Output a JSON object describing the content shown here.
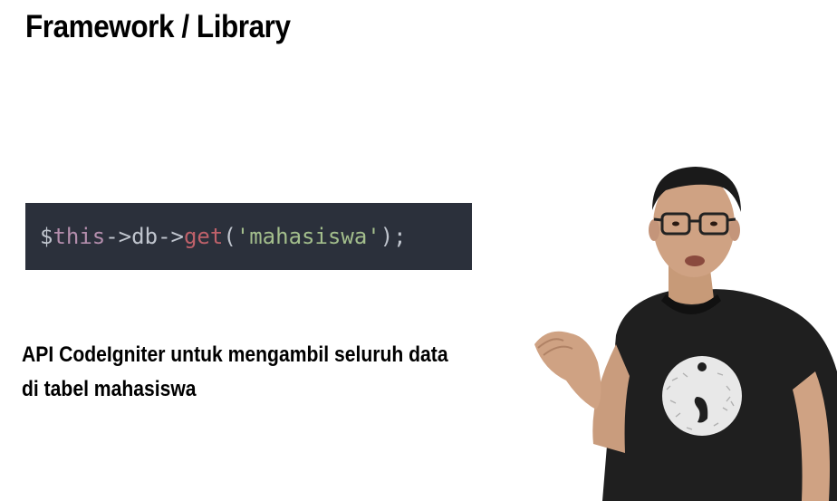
{
  "slide": {
    "title": "Framework / Library",
    "code": {
      "dollar": "$",
      "this": "this",
      "arrow1": "->",
      "prop": "db",
      "arrow2": "->",
      "method": "get",
      "open_paren": "(",
      "string": "'mahasiswa'",
      "close": ");"
    },
    "caption_line1": "API CodeIgniter untuk mengambil seluruh data",
    "caption_line2": "di tabel mahasiswa"
  },
  "colors": {
    "code_background": "#2b303b",
    "keyword": "#b48ead",
    "method": "#bf616a",
    "string": "#a3be8c",
    "plain": "#c0c5ce"
  },
  "presenter": {
    "icon": "presenter-figure",
    "shirt_logo": "semicolon-logo"
  }
}
